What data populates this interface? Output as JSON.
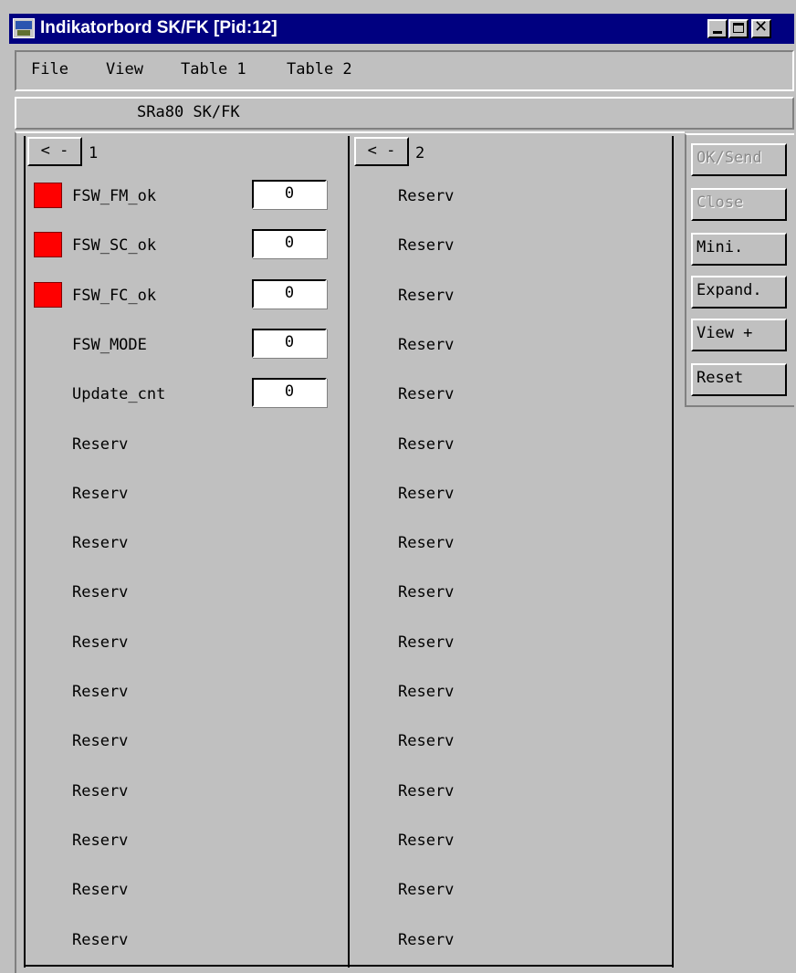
{
  "window": {
    "title": "Indikatorbord SK/FK  [Pid:12]"
  },
  "menu": [
    "File",
    "View",
    "Table 1",
    "Table 2"
  ],
  "subtitle": "SRa80 SK/FK",
  "columns": [
    {
      "nav_label": "< -",
      "number": "1",
      "rows": [
        {
          "label": "FSW_FM_ok",
          "value": "0",
          "indicator_color": "#ff0000"
        },
        {
          "label": "FSW_SC_ok",
          "value": "0",
          "indicator_color": "#ff0000"
        },
        {
          "label": "FSW_FC_ok",
          "value": "0",
          "indicator_color": "#ff0000"
        },
        {
          "label": "FSW_MODE",
          "value": "0"
        },
        {
          "label": "Update_cnt",
          "value": "0"
        },
        {
          "label": "Reserv"
        },
        {
          "label": "Reserv"
        },
        {
          "label": "Reserv"
        },
        {
          "label": "Reserv"
        },
        {
          "label": "Reserv"
        },
        {
          "label": "Reserv"
        },
        {
          "label": "Reserv"
        },
        {
          "label": "Reserv"
        },
        {
          "label": "Reserv"
        },
        {
          "label": "Reserv"
        },
        {
          "label": "Reserv"
        }
      ]
    },
    {
      "nav_label": "< -",
      "number": "2",
      "rows": [
        {
          "label": "Reserv"
        },
        {
          "label": "Reserv"
        },
        {
          "label": "Reserv"
        },
        {
          "label": "Reserv"
        },
        {
          "label": "Reserv"
        },
        {
          "label": "Reserv"
        },
        {
          "label": "Reserv"
        },
        {
          "label": "Reserv"
        },
        {
          "label": "Reserv"
        },
        {
          "label": "Reserv"
        },
        {
          "label": "Reserv"
        },
        {
          "label": "Reserv"
        },
        {
          "label": "Reserv"
        },
        {
          "label": "Reserv"
        },
        {
          "label": "Reserv"
        },
        {
          "label": "Reserv"
        }
      ]
    }
  ],
  "side_buttons": [
    {
      "label": "OK/Send",
      "enabled": false
    },
    {
      "label": "Close",
      "enabled": false
    },
    {
      "label": "Mini.",
      "enabled": true
    },
    {
      "label": "Expand.",
      "enabled": true
    },
    {
      "label": "View +",
      "enabled": true
    },
    {
      "label": "Reset",
      "enabled": true
    }
  ]
}
